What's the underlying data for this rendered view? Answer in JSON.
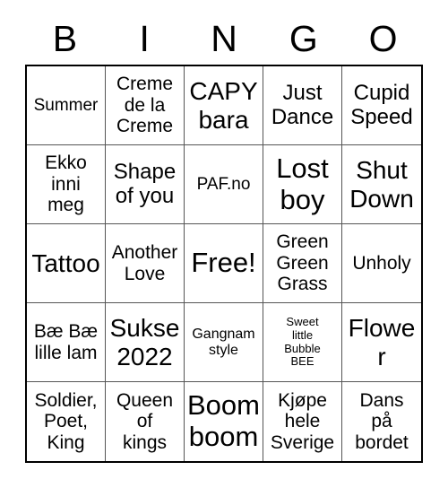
{
  "card": {
    "title": "BINGO",
    "header_letters": [
      "B",
      "I",
      "N",
      "G",
      "O"
    ],
    "grid_size": "5x5",
    "free_space": "Free!",
    "colors": {
      "background": "#ffffff",
      "text": "#000000",
      "outer_border": "#000000",
      "inner_border": "#555555"
    },
    "rows": [
      [
        {
          "text": "Summer",
          "size": "sm"
        },
        {
          "text": "Creme\nde la\nCreme",
          "size": "md"
        },
        {
          "text": "CAPY\nbara",
          "size": "xl"
        },
        {
          "text": "Just\nDance",
          "size": "lg"
        },
        {
          "text": "Cupid\nSpeed",
          "size": "lg"
        }
      ],
      [
        {
          "text": "Ekko\ninni\nmeg",
          "size": "md"
        },
        {
          "text": "Shape\nof you",
          "size": "lg"
        },
        {
          "text": "PAF.no",
          "size": "sm"
        },
        {
          "text": "Lost\nboy",
          "size": "xxl"
        },
        {
          "text": "Shut\nDown",
          "size": "xl"
        }
      ],
      [
        {
          "text": "Tattoo",
          "size": "xl"
        },
        {
          "text": "Another\nLove",
          "size": "md"
        },
        {
          "text": "Free!",
          "size": "xxl"
        },
        {
          "text": "Green\nGreen\nGrass",
          "size": "md"
        },
        {
          "text": "Unholy",
          "size": "md"
        }
      ],
      [
        {
          "text": "Bæ Bæ\nlille lam",
          "size": "md"
        },
        {
          "text": "Sukse\n2022",
          "size": "xl"
        },
        {
          "text": "Gangnam\nstyle",
          "size": "xs"
        },
        {
          "text": "Sweet\nlittle\nBubble\nBEE",
          "size": "xxs"
        },
        {
          "text": "Flower",
          "size": "xl"
        }
      ],
      [
        {
          "text": "Soldier,\nPoet,\nKing",
          "size": "md"
        },
        {
          "text": "Queen\nof\nkings",
          "size": "md"
        },
        {
          "text": "Boom\nboom",
          "size": "xxl"
        },
        {
          "text": "Kjøpe\nhele\nSverige",
          "size": "md"
        },
        {
          "text": "Dans\npå\nbordet",
          "size": "md"
        }
      ]
    ]
  }
}
